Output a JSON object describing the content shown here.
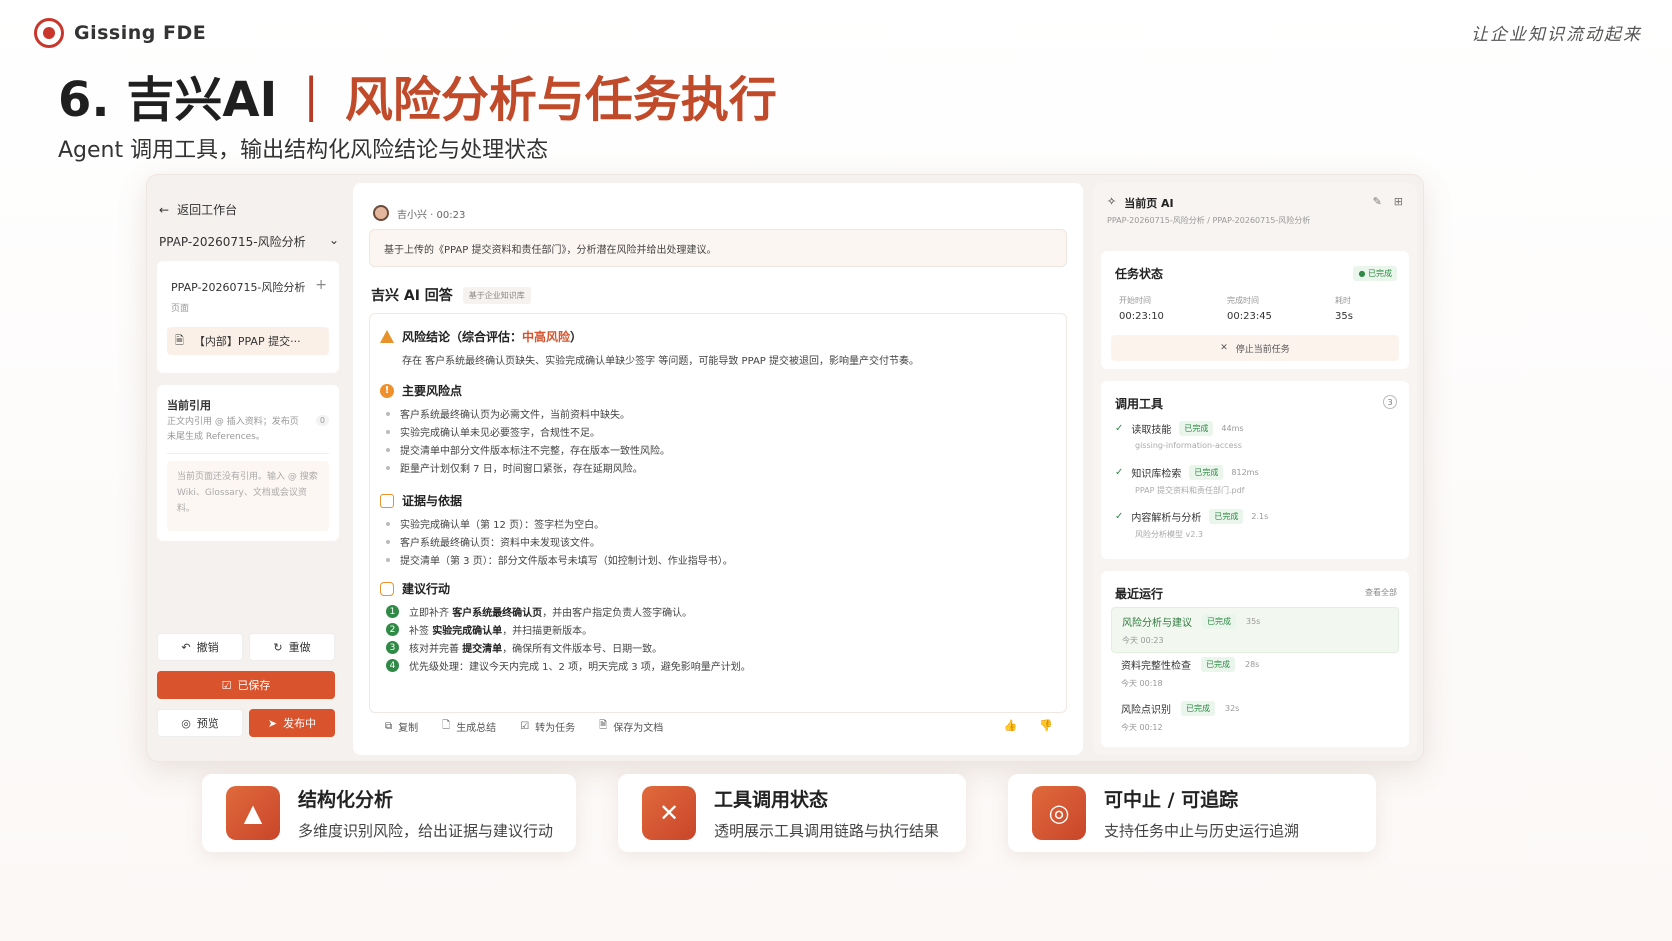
{
  "brand": {
    "name": "Gissing FDE",
    "tagline": "让企业知识流动起来"
  },
  "slide": {
    "title_main": "6. 吉兴AI",
    "title_sep": "|",
    "title_accent": "风险分析与任务执行",
    "subtitle": "Agent 调用工具，输出结构化风险结论与处理状态"
  },
  "left": {
    "back_label": "返回工作台",
    "project": "PPAP-20260715-风险分析",
    "page_name": "PPAP-20260715-风险分析",
    "page_type": "页面",
    "doc_label": "【内部】PPAP 提交···",
    "ref_title": "当前引用",
    "ref_desc": "正文内引用 @ 插入资料；发布页未尾生成 References。",
    "ref_count": "0",
    "ref_empty": "当前页面还没有引用。输入 @ 搜索 Wiki、Glossary、文档或会议资料。",
    "undo": "撤销",
    "redo": "重做",
    "saved": "已保存",
    "preview": "预览",
    "publish": "发布中"
  },
  "chat": {
    "user_line": "吉小兴 · 00:23",
    "user_msg": "基于上传的《PPAP 提交资料和责任部门》，分析潜在风险并给出处理建议。",
    "ai_name": "吉兴 AI 回答",
    "kb_tag": "基于企业知识库",
    "conclusion_title": "风险结论（综合评估：",
    "conclusion_level": "中高风险",
    "conclusion_close": "）",
    "conclusion_text": "存在 客户系统最终确认页缺失、实验完成确认单缺少签字 等问题，可能导致 PPAP 提交被退回，影响量产交付节奏。",
    "risks_title": "主要风险点",
    "risks": [
      "客户系统最终确认页为必需文件，当前资料中缺失。",
      "实验完成确认单未见必要签字，合规性不足。",
      "提交清单中部分文件版本标注不完整，存在版本一致性风险。",
      "距量产计划仅剩 7 日，时间窗口紧张，存在延期风险。"
    ],
    "evidence_title": "证据与依据",
    "evidence": [
      "实验完成确认单（第 12 页）：签字栏为空白。",
      "客户系统最终确认页：资料中未发现该文件。",
      "提交清单（第 3 页）：部分文件版本号未填写（如控制计划、作业指导书）。"
    ],
    "actions_title": "建议行动",
    "recommend": [
      {
        "n": "1",
        "pre": "立即补齐 ",
        "em": "客户系统最终确认页",
        "post": "，并由客户指定负责人签字确认。"
      },
      {
        "n": "2",
        "pre": "补签 ",
        "em": "实验完成确认单",
        "post": "，并扫描更新版本。"
      },
      {
        "n": "3",
        "pre": "核对并完善 ",
        "em": "提交清单",
        "post": "，确保所有文件版本号、日期一致。"
      },
      {
        "n": "4",
        "pre": "优先级处理：建议今天内完成 1、2 项，明天完成 3 项，避免影响量产计划。",
        "em": "",
        "post": ""
      }
    ],
    "footer": {
      "copy": "复制",
      "summary": "生成总结",
      "task": "转为任务",
      "save": "保存为文档"
    }
  },
  "panel": {
    "title": "当前页 AI",
    "path": "PPAP-20260715-风险分析 / PPAP-20260715-风险分析",
    "task_title": "任务状态",
    "task_badge": "● 已完成",
    "start_k": "开始时间",
    "start_v": "00:23:10",
    "end_k": "完成时间",
    "end_v": "00:23:45",
    "cost_k": "耗时",
    "cost_v": "35s",
    "stop": "停止当前任务",
    "tools_title": "调用工具",
    "tools_count": "3",
    "tools": [
      {
        "name": "读取技能",
        "status": "已完成",
        "ms": "44ms",
        "sub": "gissing-information-access"
      },
      {
        "name": "知识库检索",
        "status": "已完成",
        "ms": "812ms",
        "sub": "PPAP 提交资料和责任部门.pdf"
      },
      {
        "name": "内容解析与分析",
        "status": "已完成",
        "ms": "2.1s",
        "sub": "风险分析模型 v2.3"
      }
    ],
    "runs_title": "最近运行",
    "runs_all": "查看全部",
    "runs": [
      {
        "name": "风险分析与建议",
        "status": "已完成",
        "dur": "35s",
        "time": "今天 00:23"
      },
      {
        "name": "资料完整性检查",
        "status": "已完成",
        "dur": "28s",
        "time": "今天 00:18"
      },
      {
        "name": "风险点识别",
        "status": "已完成",
        "dur": "32s",
        "time": "今天 00:12"
      }
    ]
  },
  "features": [
    {
      "title": "结构化分析",
      "desc": "多维度识别风险，给出证据与建议行动"
    },
    {
      "title": "工具调用状态",
      "desc": "透明展示工具调用链路与执行结果"
    },
    {
      "title": "可中止 / 可追踪",
      "desc": "支持任务中止与历史运行追溯"
    }
  ]
}
